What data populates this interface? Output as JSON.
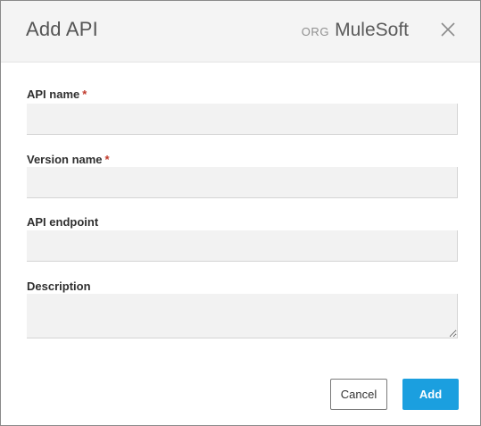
{
  "dialog": {
    "title": "Add API",
    "org_label": "ORG",
    "org_name": "MuleSoft"
  },
  "icons": {
    "close": "close-icon"
  },
  "fields": {
    "api_name": {
      "label": "API name",
      "required_marker": "*",
      "value": "",
      "placeholder": ""
    },
    "version_name": {
      "label": "Version name",
      "required_marker": "*",
      "value": "",
      "placeholder": ""
    },
    "api_endpoint": {
      "label": "API endpoint",
      "value": "",
      "placeholder": ""
    },
    "description": {
      "label": "Description",
      "value": "",
      "placeholder": ""
    }
  },
  "actions": {
    "cancel_label": "Cancel",
    "add_label": "Add"
  },
  "colors": {
    "primary": "#1b9fdf",
    "required": "#c0392b",
    "header_bg": "#f4f4f4",
    "input_bg": "#f2f2f2"
  }
}
